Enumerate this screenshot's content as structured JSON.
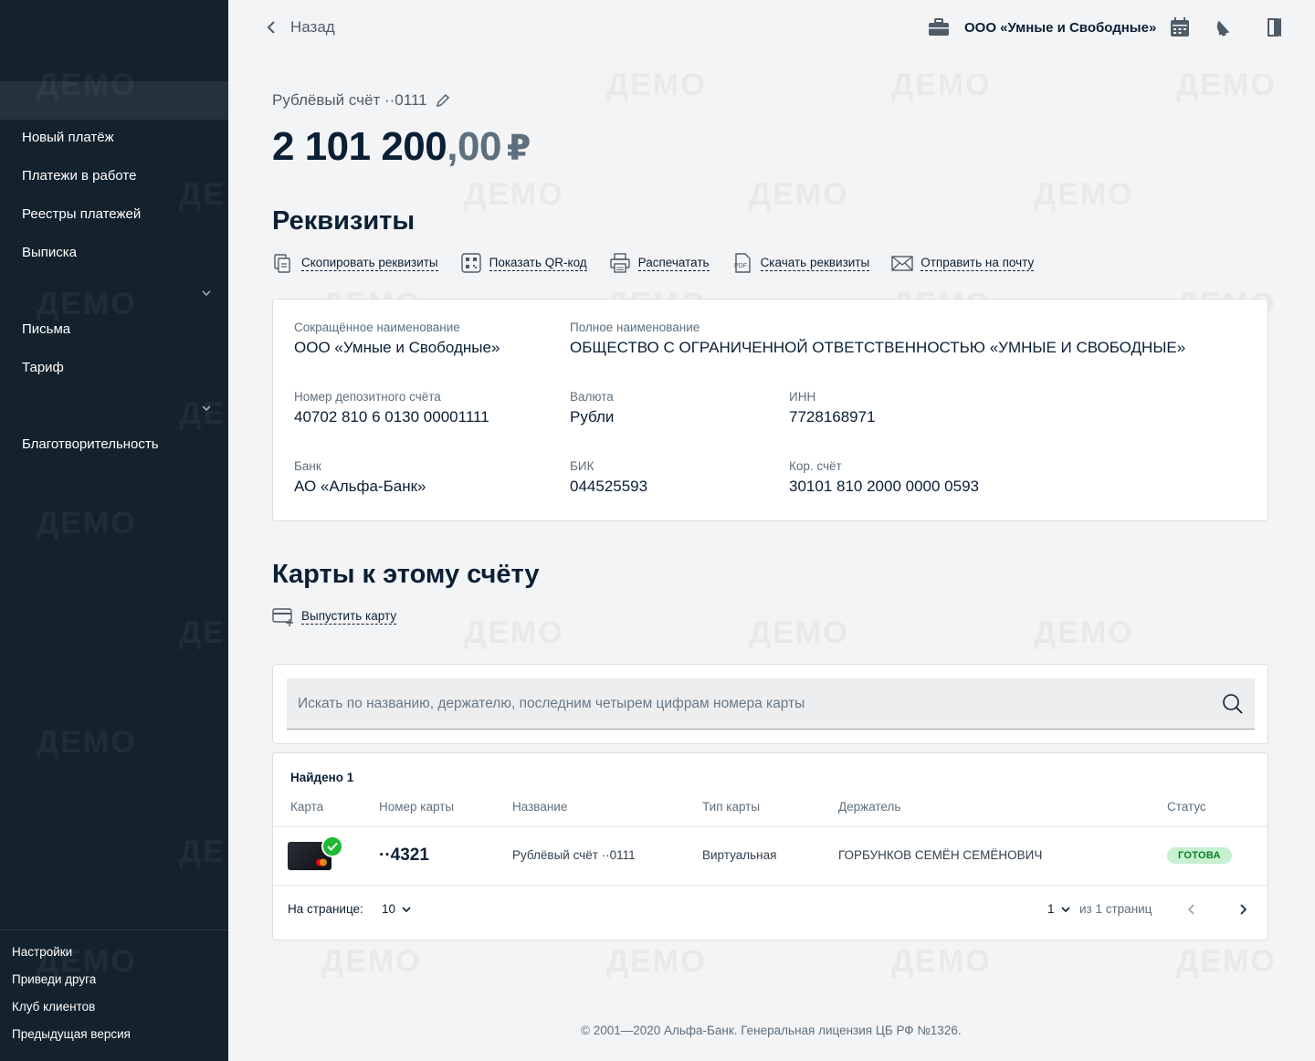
{
  "sidebar": {
    "items": [
      {
        "label": "Новый платёж"
      },
      {
        "label": "Платежи в работе"
      },
      {
        "label": "Реестры платежей"
      },
      {
        "label": "Выписка"
      },
      {
        "label": "Письма"
      },
      {
        "label": "Тариф"
      },
      {
        "label": "Благотворительность"
      }
    ],
    "bottom": [
      {
        "label": "Настройки"
      },
      {
        "label": "Приведи друга"
      },
      {
        "label": "Клуб клиентов"
      },
      {
        "label": "Предыдущая версия"
      }
    ]
  },
  "watermark": "ДЕМО",
  "header": {
    "back_label": "Назад",
    "org_name": "ООО «Умные и Свободные»",
    "icons": [
      "briefcase-icon",
      "calendar-icon",
      "bell-icon",
      "logout-icon"
    ]
  },
  "account": {
    "name": "Рублёвый счёт ··0111",
    "balance_int": "2 101 200",
    "balance_dec": ",00",
    "currency": "₽"
  },
  "requisites": {
    "title": "Реквизиты",
    "actions": [
      {
        "label": "Скопировать реквизиты",
        "icon": "copy-icon"
      },
      {
        "label": "Показать QR-код",
        "icon": "qr-icon"
      },
      {
        "label": "Распечатать",
        "icon": "printer-icon"
      },
      {
        "label": "Скачать реквизиты",
        "icon": "pdf-icon"
      },
      {
        "label": "Отправить на почту",
        "icon": "mail-icon"
      }
    ],
    "fields": {
      "short_name": {
        "label": "Сокращённое наименование",
        "value": "ООО «Умные и Свободные»"
      },
      "full_name": {
        "label": "Полное наименование",
        "value": "ОБЩЕСТВО С ОГРАНИЧЕННОЙ ОТВЕТСТВЕННОСТЬЮ «УМНЫЕ И СВОБОДНЫЕ»"
      },
      "deposit_account": {
        "label": "Номер депозитного счёта",
        "value": "40702 810 6 0130 00001111"
      },
      "currency": {
        "label": "Валюта",
        "value": "Рубли"
      },
      "inn": {
        "label": "ИНН",
        "value": "7728168971"
      },
      "bank": {
        "label": "Банк",
        "value": "АО «Альфа-Банк»"
      },
      "bik": {
        "label": "БИК",
        "value": "044525593"
      },
      "corr_account": {
        "label": "Кор. счёт",
        "value": "30101 810 2000 0000 0593"
      }
    }
  },
  "cards": {
    "title": "Карты к этому счёту",
    "issue_label": "Выпустить карту",
    "search_placeholder": "Искать по названию, держателю, последним четырем цифрам номера карты",
    "found": "Найдено 1",
    "columns": [
      "Карта",
      "Номер карты",
      "Название",
      "Тип карты",
      "Держатель",
      "Статус"
    ],
    "rows": [
      {
        "number": "··4321",
        "name": "Рублёвый счёт ··0111",
        "type": "Виртуальная",
        "holder": "ГОРБУНКОВ СЕМЁН СЕМЁНОВИЧ",
        "status": "ГОТОВА"
      }
    ],
    "pager": {
      "per_page_label": "На странице:",
      "per_page_value": "10",
      "page_value": "1",
      "of_pages": "из 1 страниц"
    }
  },
  "footer": "© 2001—2020 Альфа-Банк. Генеральная лицензия ЦБ РФ №1326."
}
